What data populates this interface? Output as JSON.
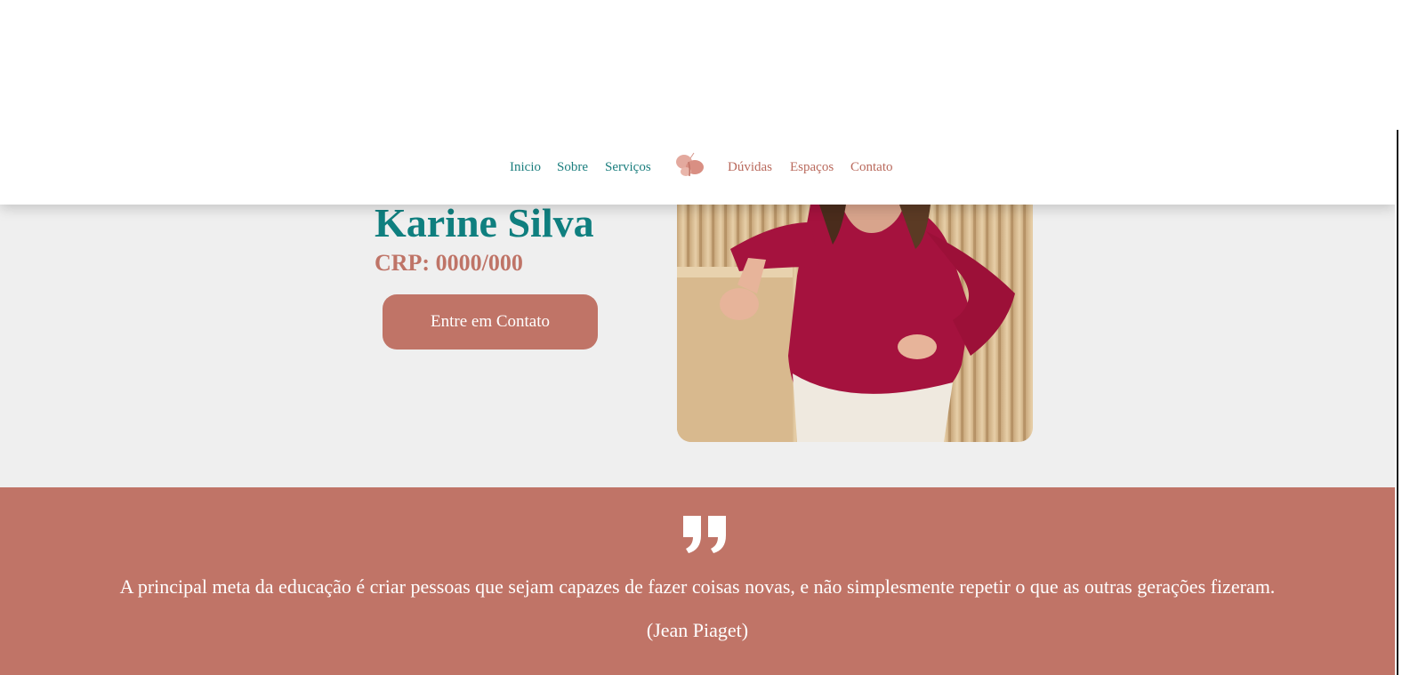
{
  "nav": {
    "left": [
      {
        "label": "Inicio"
      },
      {
        "label": "Sobre"
      },
      {
        "label": "Serviços"
      }
    ],
    "logo_icon": "butterfly-icon",
    "right": [
      {
        "label": "Dúvidas"
      },
      {
        "label": "Espaços"
      },
      {
        "label": "Contato"
      }
    ]
  },
  "hero": {
    "name": "Karine Silva",
    "crp": "CRP: 0000/000",
    "cta_label": "Entre em Contato",
    "photo_icon": "portrait-photo"
  },
  "quote": {
    "icon": "quote-icon",
    "text": "A principal meta da educação é criar pessoas que sejam capazes de fazer coisas novas, e não simplesmente repetir o que as outras gerações fizeram.",
    "author": "(Jean Piaget)"
  },
  "colors": {
    "teal": "#0f7f7f",
    "terracotta": "#c07467",
    "background": "#efefef"
  }
}
